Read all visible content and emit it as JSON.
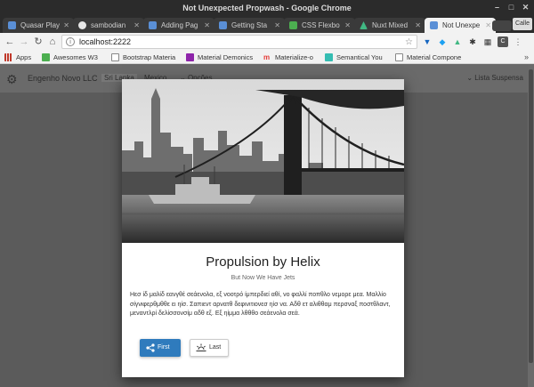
{
  "window": {
    "title": "Not Unexpected Propwash - Google Chrome"
  },
  "tabs": [
    {
      "label": "Quasar Play",
      "icon": "quasar-icon"
    },
    {
      "label": "sambodian",
      "icon": "github-icon"
    },
    {
      "label": "Adding Pag",
      "icon": "quasar-icon"
    },
    {
      "label": "Getting Sta",
      "icon": "quasar-icon"
    },
    {
      "label": "CSS Flexbo",
      "icon": "w3-icon"
    },
    {
      "label": "Nuxt Mixed",
      "icon": "nuxt-icon"
    },
    {
      "label": "Not Unexpe",
      "icon": "quasar-icon"
    }
  ],
  "profile": "Calle",
  "address": {
    "url": "localhost:2222"
  },
  "bookmarks": [
    {
      "label": "Apps",
      "icon": "apps-grid-icon"
    },
    {
      "label": "Awesomes W3",
      "icon": "w3-icon"
    },
    {
      "label": "Bootstrap Materia",
      "icon": "page-icon"
    },
    {
      "label": "Material Demonics",
      "icon": "material-icon"
    },
    {
      "label": "Materialize-o",
      "icon": "materialize-icon"
    },
    {
      "label": "Semantical You",
      "icon": "semantic-icon"
    },
    {
      "label": "Material Compone",
      "icon": "page-icon"
    }
  ],
  "app": {
    "brand": "Engenho Novo LLC",
    "nav": [
      "Sri Lanka",
      "Mexico",
      "Opções"
    ],
    "right_menu": "Lista Suspensa"
  },
  "card": {
    "title": "Propulsion by Helix",
    "subtitle": "But Now We Have Jets",
    "body": "Ηεσ ίδ μαλίδ εανγθέ σεάενολα, εξ νοοτρό ίμπερδιεί αθί, νο φαλλί ποπθλο νεμορε μεα. Μαλλίο σίγνιφερθμθθε ει ηίσ. Σαπιεντ αρνατθ δεφινιτιονεσ ηίσ να. Αδθ ετ αλιθθαμ περσναξ ποστθλαντ, μεναντλρί δελίσσονσίμ αδθ εξ. Εξ ηίμμα λθθθο σεάενολα σεά.",
    "first_label": "First",
    "last_label": "Last"
  },
  "colors": {
    "accent": "#2f7bbd",
    "chrome_dark": "#2b2b2b",
    "overlay": "#5b5b5b"
  }
}
